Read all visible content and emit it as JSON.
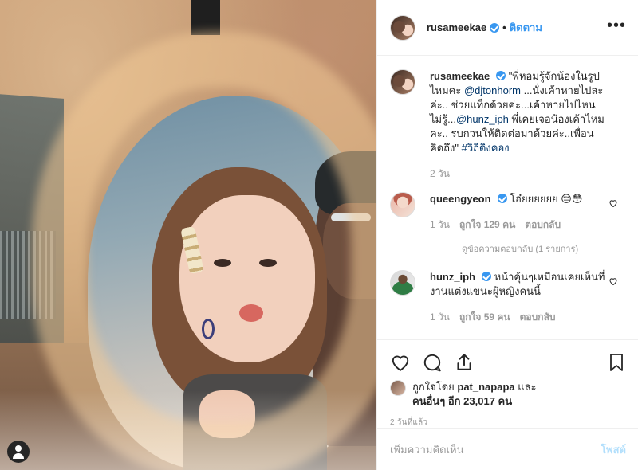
{
  "header": {
    "username": "rusameekae",
    "separator": "•",
    "follow_label": "ติดตาม",
    "more_label": "•••"
  },
  "caption": {
    "username": "rusameekae",
    "text_1": "\"พี่หอมรู้จักน้องในรูปไหมคะ ",
    "mention_1": "@djtonhorm",
    "text_2": " ...นั่งเค้าหายไปละค่ะ.. ช่วยแท็กด้วยค่ะ...เค้าหายไปไหนไม่รู้...",
    "mention_2": "@hunz_iph",
    "text_3": " พี่เคยเจอน้องเค้าไหมคะ.. รบกวนให้ติดต่อมาด้วยค่ะ..เพื่อนคิดถึง\" ",
    "hashtag": "#วิถีดิงคอง",
    "time": "2 วัน"
  },
  "comments": [
    {
      "username": "queengyeon",
      "text": "โอ๋ยยยยยย 😔😳",
      "time": "1 วัน",
      "likes": "ถูกใจ 129 คน",
      "reply_label": "ตอบกลับ",
      "view_replies": "ดูข้อความตอบกลับ (1 รายการ)"
    },
    {
      "username": "hunz_iph",
      "text": "หน้าคุ้นๆเหมือนเคยเห็นที่งานแต่งแขนะผู้หญิงคนนี้",
      "time": "1 วัน",
      "likes": "ถูกใจ 59 คน",
      "reply_label": "ตอบกลับ"
    }
  ],
  "likes": {
    "prefix": "ถูกใจโดย ",
    "user": "pat_napapa",
    "conj": " และ",
    "others": "คนอื่นๆ อีก 23,017 คน"
  },
  "timeago": "2 วันที่แล้ว",
  "add_comment": {
    "placeholder": "เพิ่มความคิดเห็น",
    "post_label": "โพสต์"
  },
  "colors": {
    "accent": "#3897f0",
    "link": "#003569",
    "muted": "#999999",
    "post_disabled": "#b2dffc"
  },
  "icons": [
    "user-tag-icon",
    "heart-icon",
    "comment-icon",
    "share-icon",
    "bookmark-icon",
    "verified-icon",
    "more-icon"
  ]
}
